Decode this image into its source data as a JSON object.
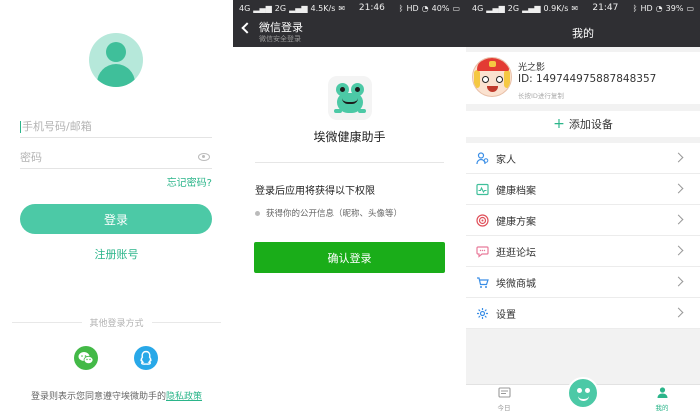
{
  "screen1": {
    "input_phone_placeholder": "手机号码/邮箱",
    "input_password_placeholder": "密码",
    "forgot_password": "忘记密码?",
    "login_button": "登录",
    "register": "注册账号",
    "other_login": "其他登录方式",
    "policy_text": "登录则表示您同意遵守埃微助手的",
    "policy_link": "隐私政策",
    "colors": {
      "accent": "#4cc9a6",
      "wechat": "#43b947",
      "qq": "#28a8e8"
    }
  },
  "screen2": {
    "status": {
      "network": "4G",
      "signal": "2G",
      "speed": "4.5K/s",
      "time": "21:46",
      "bt": "HD",
      "battery": "40%"
    },
    "header_title": "微信登录",
    "header_subtitle": "微信安全登录",
    "app_name": "埃微健康助手",
    "permission_title": "登录后应用将获得以下权限",
    "permission_item": "获得你的公开信息（昵称、头像等）",
    "confirm_button": "确认登录",
    "colors": {
      "confirm": "#1aad19"
    }
  },
  "screen3": {
    "status": {
      "network": "4G",
      "signal": "2G",
      "speed": "0.9K/s",
      "time": "21:47",
      "bt": "HD",
      "battery": "39%"
    },
    "header_title": "我的",
    "profile": {
      "name": "光之影",
      "id": "ID: 149744975887848357",
      "hint": "长按ID进行复制"
    },
    "add_device": "添加设备",
    "menu": [
      {
        "label": "家人",
        "icon": "family-icon"
      },
      {
        "label": "健康档案",
        "icon": "health-record-icon"
      },
      {
        "label": "健康方案",
        "icon": "health-plan-icon"
      },
      {
        "label": "逛逛论坛",
        "icon": "forum-icon"
      },
      {
        "label": "埃微商城",
        "icon": "shop-icon"
      },
      {
        "label": "设置",
        "icon": "settings-icon"
      }
    ],
    "tabs": {
      "today": "今日",
      "me": "我的"
    }
  }
}
